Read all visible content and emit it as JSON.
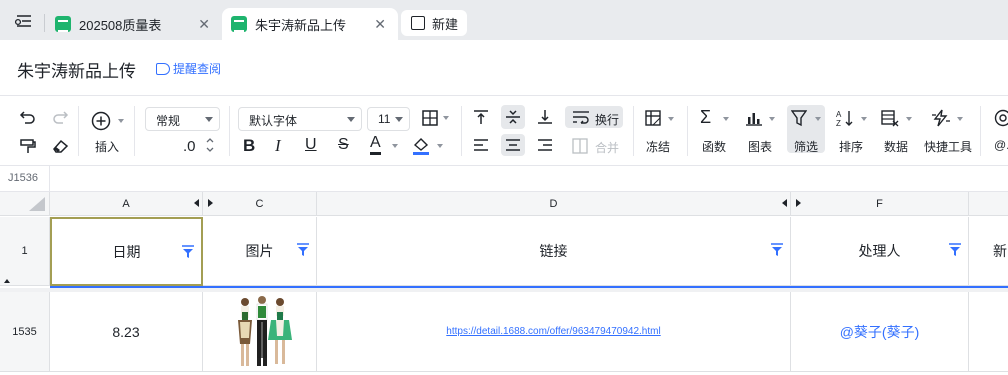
{
  "tabs": [
    {
      "label": "202508质量表",
      "icon": "sheet-icon"
    },
    {
      "label": "朱宇涛新品上传",
      "icon": "sheet-icon",
      "active": true
    }
  ],
  "new_tab_label": "新建",
  "doc": {
    "title": "朱宇涛新品上传",
    "remind_label": "提醒查阅"
  },
  "toolbar": {
    "number_format": "常规",
    "font_family": "默认字体",
    "font_size": "11",
    "decimal_label": ".0",
    "wrap_label": "换行",
    "merge_label": "合并",
    "insert_label": "插入",
    "freeze_label": "冻结",
    "function_label": "函数",
    "chart_label": "图表",
    "filter_label": "筛选",
    "sort_label": "排序",
    "data_label": "数据",
    "quicktools_label": "快捷工具",
    "more_label": "@...",
    "accent": "#3370ff"
  },
  "namebar": {
    "cell_ref": "J1536"
  },
  "grid": {
    "columns": [
      "A",
      "C",
      "D",
      "F"
    ],
    "header_row_number": "1",
    "headers": [
      "日期",
      "图片",
      "链接",
      "处理人",
      "新"
    ],
    "row": {
      "number": "1535",
      "date": "8.23",
      "link": "https://detail.1688.com/offer/963479470942.html",
      "handler": "@葵子(葵子)"
    }
  }
}
